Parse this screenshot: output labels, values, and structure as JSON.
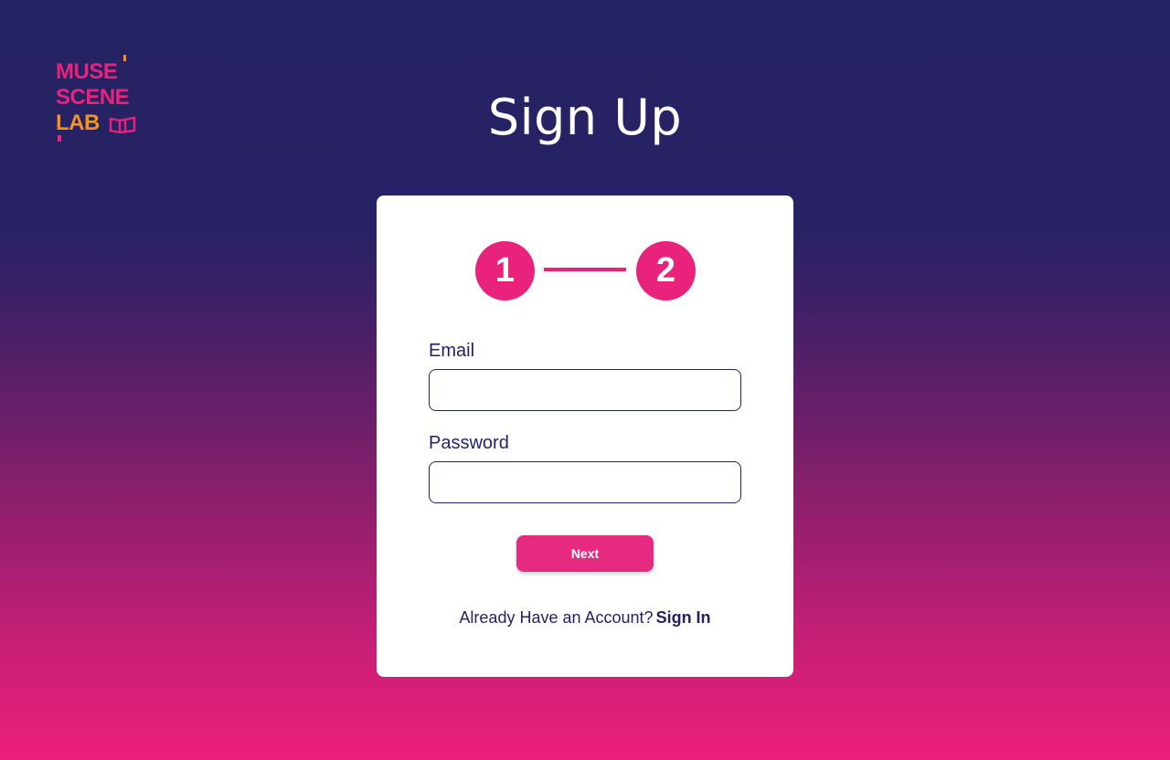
{
  "logo": {
    "line1": "MUSE",
    "line2": "SCENE",
    "line3": "LAB",
    "colors": {
      "pink": "#e9237c",
      "orange": "#f6921e"
    }
  },
  "page": {
    "title": "Sign Up"
  },
  "stepper": {
    "steps": [
      "1",
      "2"
    ],
    "accent": "#e9237c"
  },
  "form": {
    "email_label": "Email",
    "email_value": "",
    "password_label": "Password",
    "password_value": "",
    "next_label": "Next"
  },
  "footer": {
    "prompt": "Already Have an Account?",
    "signin_label": "Sign In"
  },
  "colors": {
    "navy": "#252264",
    "pink": "#e62a7f",
    "background_top": "#252264",
    "background_bottom": "#ec1f7c"
  }
}
